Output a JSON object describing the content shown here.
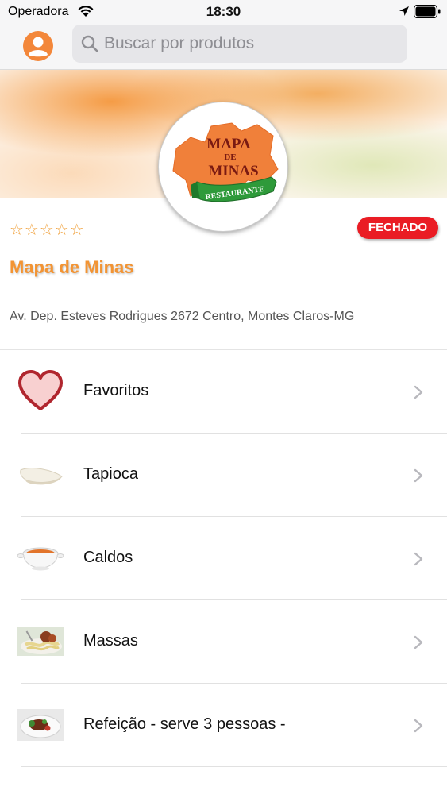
{
  "status_bar": {
    "carrier": "Operadora",
    "time": "18:30"
  },
  "search": {
    "placeholder": "Buscar por produtos"
  },
  "store": {
    "rating_stars": "☆☆☆☆☆",
    "rating": 0,
    "status": "FECHADO",
    "name": "Mapa de Minas",
    "address": "Av. Dep. Esteves Rodrigues 2672 Centro, Montes Claros-MG",
    "logo": {
      "line1": "MAPA",
      "line2": "DE",
      "line3": "MINAS",
      "ribbon": "RESTAURANTE"
    }
  },
  "categories": [
    {
      "label": "Favoritos",
      "icon": "heart-icon"
    },
    {
      "label": "Tapioca",
      "icon": "tapioca-thumbnail"
    },
    {
      "label": "Caldos",
      "icon": "soup-bowl-thumbnail"
    },
    {
      "label": "Massas",
      "icon": "pasta-thumbnail"
    },
    {
      "label": "Refeição - serve 3 pessoas -",
      "icon": "meal-thumbnail"
    }
  ],
  "colors": {
    "accent": "#f39433",
    "closed_badge": "#ea1c24",
    "avatar": "#f3873a"
  }
}
